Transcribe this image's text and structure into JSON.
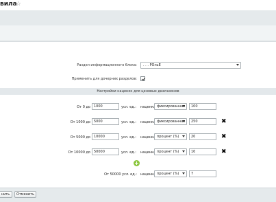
{
  "header": {
    "title": "вила",
    "star_icon": "star-icon"
  },
  "form": {
    "iblock_section_label": "Раздел информационного блока:",
    "iblock_section_value": ". . . POльE",
    "apply_children_label": "Применить для дочерних разделов:",
    "apply_children_checked": true
  },
  "section": {
    "title": "Настройки наценок для ценовых диапазонов"
  },
  "rows": [
    {
      "range_label": "От 0 до",
      "to_value": "1000",
      "unit_label": "усл. ед.:",
      "markup_label": "наценка",
      "type": "фиксированная",
      "value": "100",
      "deletable": false
    },
    {
      "range_label": "От 1000 до",
      "to_value": "5000",
      "unit_label": "усл. ед.:",
      "markup_label": "наценка",
      "type": "фиксированная",
      "value": "250",
      "deletable": true
    },
    {
      "range_label": "От 5000 до",
      "to_value": "10000",
      "unit_label": "усл. ед.:",
      "markup_label": "наценка",
      "type": "процент (%)",
      "value": "20",
      "deletable": true
    },
    {
      "range_label": "От 10000 до",
      "to_value": "50000",
      "unit_label": "усл. ед.:",
      "markup_label": "наценка",
      "type": "процент (%)",
      "value": "10",
      "deletable": true
    }
  ],
  "last_row": {
    "range_label": "От 50000 усл. ед.:",
    "markup_label": "наценка",
    "type": "процент (%)",
    "value": "7"
  },
  "footer": {
    "save_label": "нить",
    "cancel_label": "Отменить"
  }
}
